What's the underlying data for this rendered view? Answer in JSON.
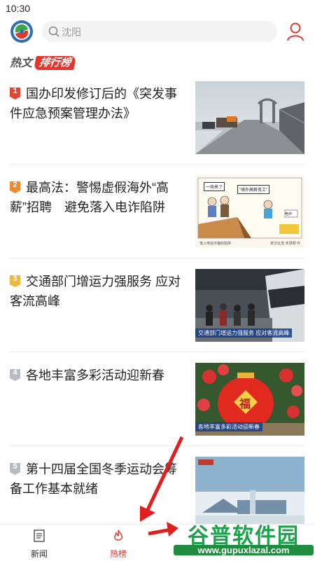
{
  "status": {
    "time": "10:30"
  },
  "search": {
    "placeholder": "沈阳"
  },
  "rank": {
    "prefix": "热文",
    "tag": "排行榜"
  },
  "items": [
    {
      "rank": "1",
      "title": "国办印发修订后的《突发事件应急预案管理办法》",
      "badge_color": "#e5452f"
    },
    {
      "rank": "2",
      "title": "最高法：警惕虚假海外“高薪”招聘　避免落入电诈陷阱",
      "badge_color": "#f08a2b"
    },
    {
      "rank": "3",
      "title": "交通部门增运力强服务 应对客流高峰",
      "badge_color": "#f3b53b"
    },
    {
      "rank": "4",
      "title": "各地丰富多彩活动迎新春",
      "badge_color": "#b7bcc4"
    },
    {
      "rank": "5",
      "title": "第十四届全国冬季运动会筹备工作基本就绪",
      "badge_color": "#b7bcc4"
    }
  ],
  "thumbs": {
    "t2_left": "一块来了",
    "t2_right": "“境外高薪务工”",
    "t2_sign": "电诈",
    "t2_footer_left": "落入电信诈骗的陷阱",
    "t2_footer_right": "新华社发 朱慧卿 作",
    "t3_caption": "交通部门增运力强服务 应对客流高峰",
    "t4_caption": "各地丰富多彩活动迎新春",
    "t4_char": "福"
  },
  "nav": {
    "news": "新闻",
    "hot": "热榜"
  },
  "watermark": {
    "title": "谷普软件园",
    "url": "www.gupuxlazal.com"
  },
  "colors": {
    "accent": "#e4362a",
    "tab_inactive": "#333333"
  }
}
